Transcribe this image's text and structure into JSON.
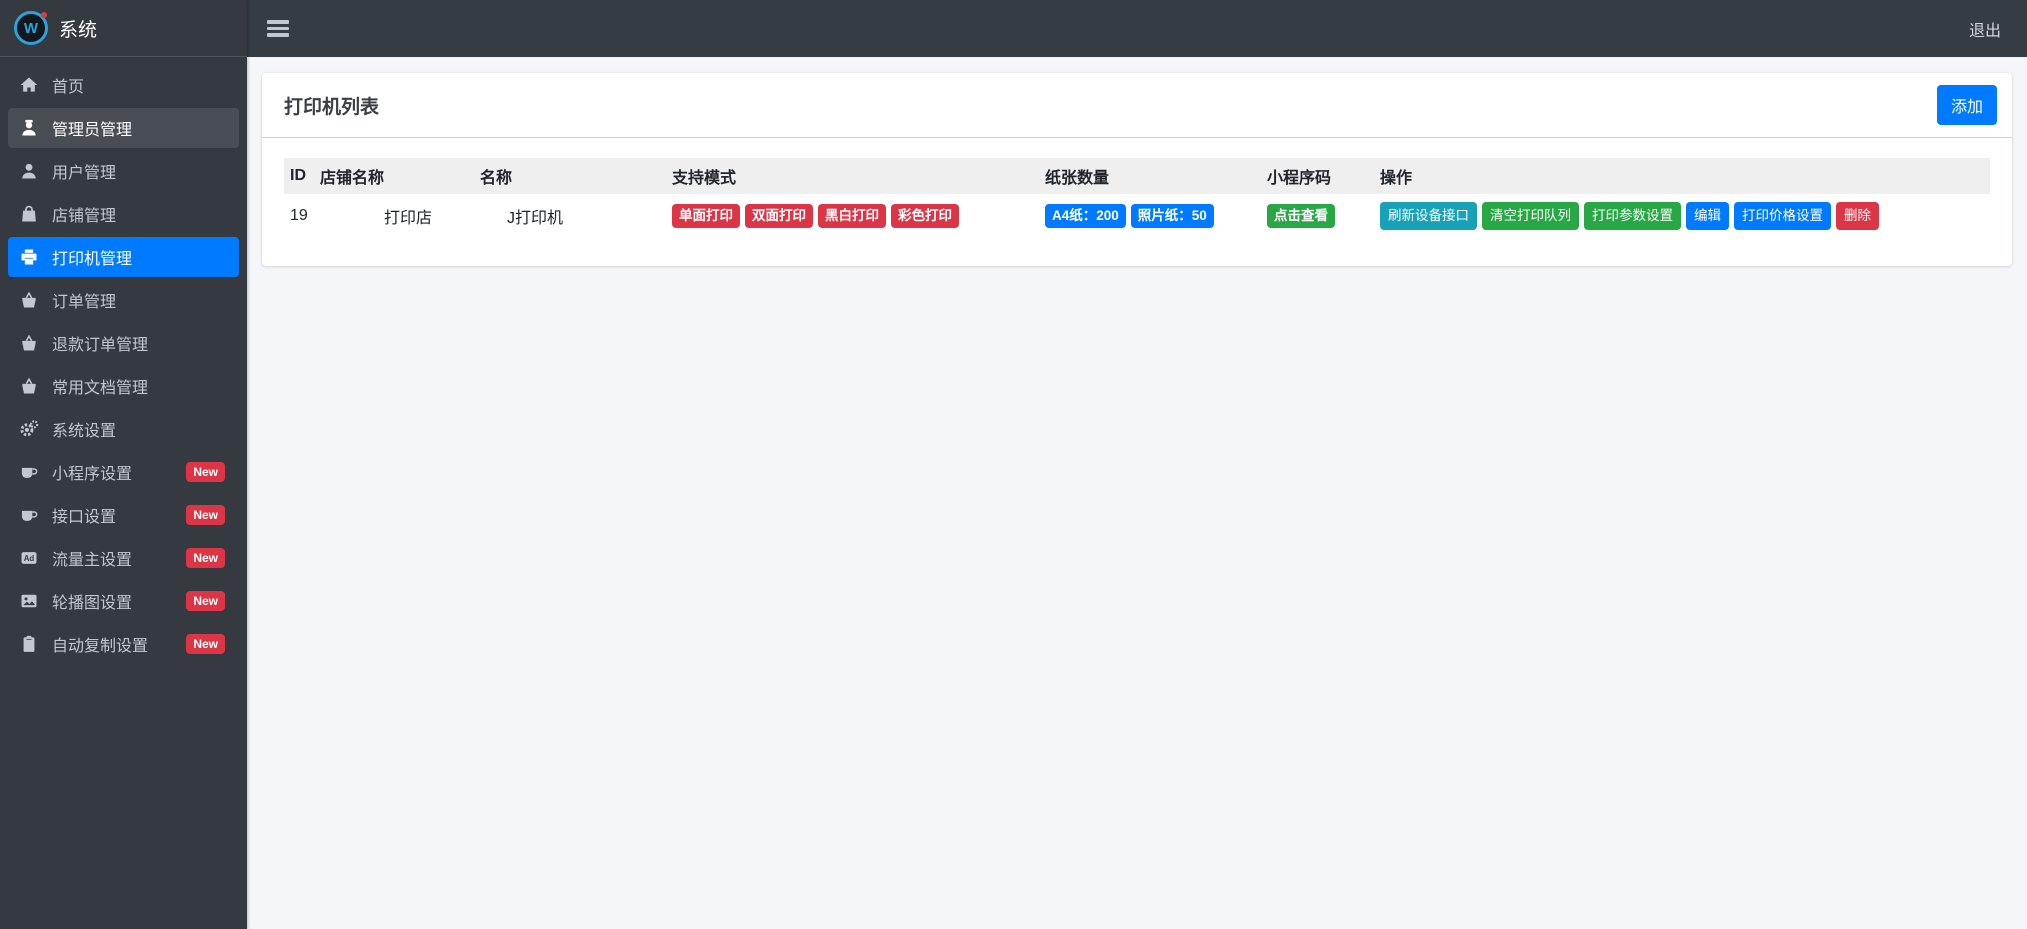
{
  "colors": {
    "primary": "#007bff",
    "success": "#28a745",
    "info": "#17a2b8",
    "danger": "#dc3545",
    "sidebar_bg": "#343a40",
    "navbar_bg": "#363c43",
    "content_bg": "#f4f6f9",
    "active_item_bg": "#007bff",
    "new_badge_bg": "#dc3545",
    "table_header_bg": "#efefef"
  },
  "brand": {
    "logo_letter": "W",
    "title": "系统"
  },
  "topbar": {
    "logout_label": "退出"
  },
  "sidebar": {
    "items": [
      {
        "key": "home",
        "label": "首页",
        "icon": "home-icon",
        "state": ""
      },
      {
        "key": "admin-management",
        "label": "管理员管理",
        "icon": "admin-icon",
        "state": "highlight"
      },
      {
        "key": "user-management",
        "label": "用户管理",
        "icon": "user-icon",
        "state": ""
      },
      {
        "key": "shop-management",
        "label": "店铺管理",
        "icon": "bag-icon",
        "state": ""
      },
      {
        "key": "printer-management",
        "label": "打印机管理",
        "icon": "printer-icon",
        "state": "active"
      },
      {
        "key": "order-management",
        "label": "订单管理",
        "icon": "basket-icon",
        "state": ""
      },
      {
        "key": "refund-order-management",
        "label": "退款订单管理",
        "icon": "basket-icon",
        "state": ""
      },
      {
        "key": "document-management",
        "label": "常用文档管理",
        "icon": "basket-icon",
        "state": ""
      },
      {
        "key": "system-settings",
        "label": "系统设置",
        "icon": "gears-icon",
        "state": ""
      },
      {
        "key": "miniprogram-settings",
        "label": "小程序设置",
        "icon": "coffee-icon",
        "state": "",
        "badge": "New"
      },
      {
        "key": "api-settings",
        "label": "接口设置",
        "icon": "coffee-icon",
        "state": "",
        "badge": "New"
      },
      {
        "key": "ad-settings",
        "label": "流量主设置",
        "icon": "ad-icon",
        "state": "",
        "badge": "New"
      },
      {
        "key": "carousel-settings",
        "label": "轮播图设置",
        "icon": "image-icon",
        "state": "",
        "badge": "New"
      },
      {
        "key": "autocopy-settings",
        "label": "自动复制设置",
        "icon": "clipboard-icon",
        "state": "",
        "badge": "New"
      }
    ]
  },
  "page": {
    "card_title": "打印机列表",
    "add_button_label": "添加"
  },
  "table": {
    "columns": [
      "ID",
      "店铺名称",
      "名称",
      "支持模式",
      "纸张数量",
      "小程序码",
      "操作"
    ],
    "rows": [
      {
        "id": "19",
        "shop_name": "打印店",
        "name": "J打印机",
        "modes": [
          "单面打印",
          "双面打印",
          "黑白打印",
          "彩色打印"
        ],
        "paper_badges": [
          "A4纸：200",
          "照片纸：50"
        ],
        "qrcode_label": "点击查看",
        "actions": [
          {
            "key": "refresh-device-api",
            "label": "刷新设备接口",
            "color": "info"
          },
          {
            "key": "clear-print-queue",
            "label": "清空打印队列",
            "color": "success"
          },
          {
            "key": "print-param-settings",
            "label": "打印参数设置",
            "color": "success"
          },
          {
            "key": "edit",
            "label": "编辑",
            "color": "primary"
          },
          {
            "key": "print-price-settings",
            "label": "打印价格设置",
            "color": "primary"
          },
          {
            "key": "delete",
            "label": "删除",
            "color": "danger"
          }
        ]
      }
    ]
  }
}
